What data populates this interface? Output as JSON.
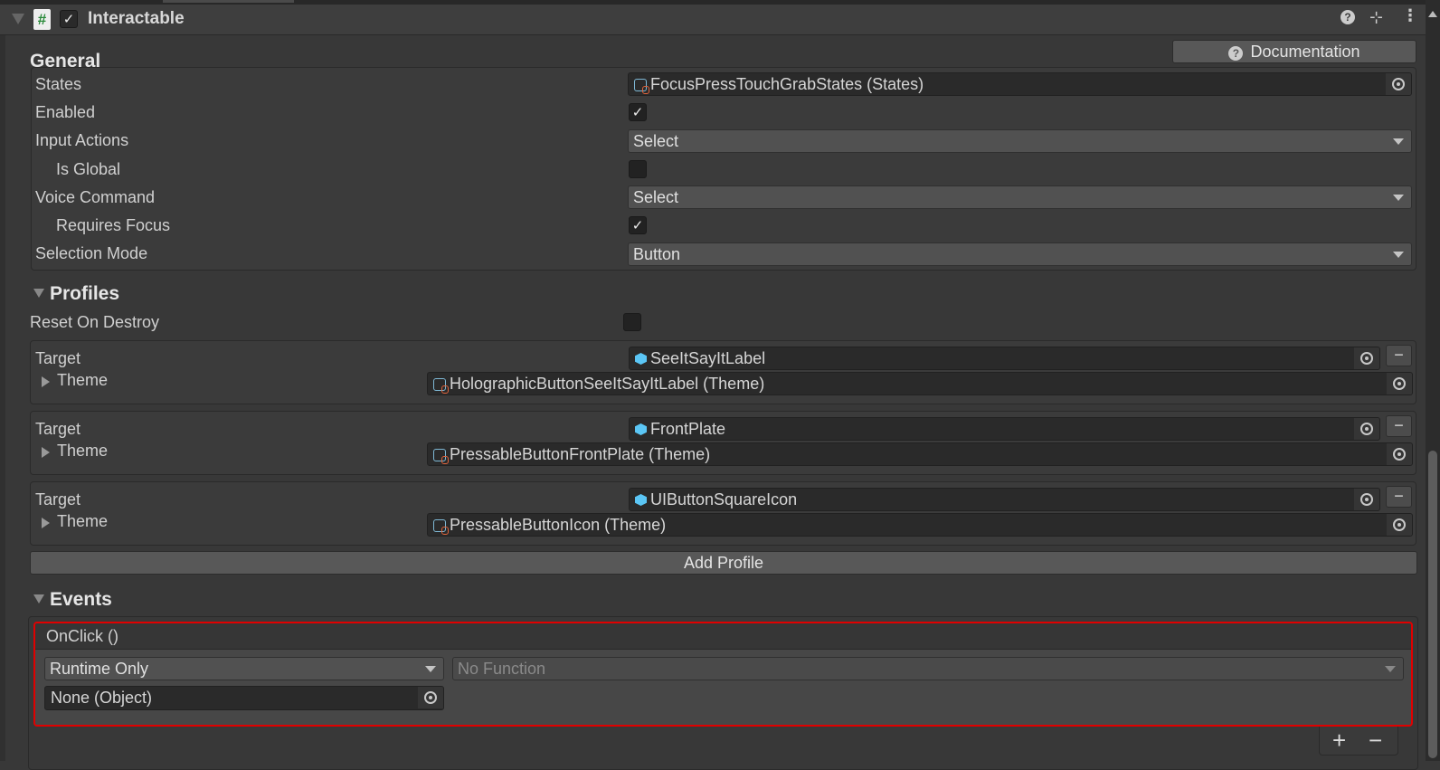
{
  "component": {
    "title": "Interactable",
    "enabled": true
  },
  "header_icons": [
    "help-icon",
    "presets-icon",
    "more-icon"
  ],
  "documentation_label": "Documentation",
  "general": {
    "title": "General",
    "states_label": "States",
    "states_value": "FocusPressTouchGrabStates (States)",
    "enabled_label": "Enabled",
    "enabled_checked": true,
    "input_actions_label": "Input Actions",
    "input_actions_value": "Select",
    "is_global_label": "Is Global",
    "is_global_checked": false,
    "voice_command_label": "Voice Command",
    "voice_command_value": "Select",
    "requires_focus_label": "Requires Focus",
    "requires_focus_checked": true,
    "selection_mode_label": "Selection Mode",
    "selection_mode_value": "Button"
  },
  "profiles": {
    "title": "Profiles",
    "reset_on_destroy_label": "Reset On Destroy",
    "reset_on_destroy_checked": false,
    "items": [
      {
        "target_label": "Target",
        "target": "SeeItSayItLabel",
        "theme_label": "Theme",
        "theme": "HolographicButtonSeeItSayItLabel (Theme)"
      },
      {
        "target_label": "Target",
        "target": "FrontPlate",
        "theme_label": "Theme",
        "theme": "PressableButtonFrontPlate (Theme)"
      },
      {
        "target_label": "Target",
        "target": "UIButtonSquareIcon",
        "theme_label": "Theme",
        "theme": "PressableButtonIcon (Theme)"
      }
    ],
    "add_profile_label": "Add Profile"
  },
  "events": {
    "title": "Events",
    "onclick_label": "OnClick ()",
    "runtime_value": "Runtime Only",
    "function_value": "No Function",
    "object_value": "None (Object)",
    "plus": "+",
    "minus": "−"
  },
  "colors": {
    "highlight": "#e00000",
    "accent_cube": "#5bc6f5"
  }
}
